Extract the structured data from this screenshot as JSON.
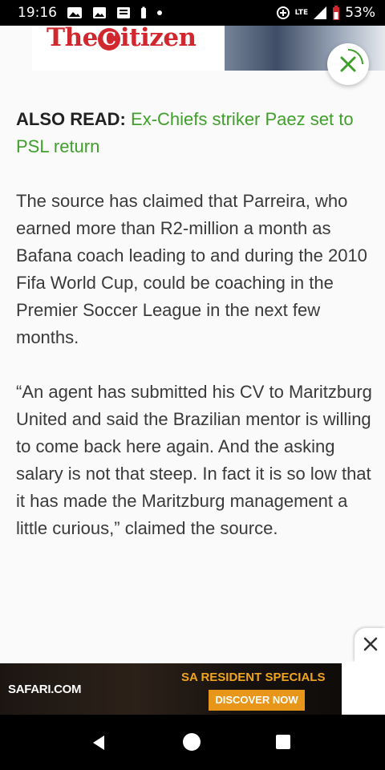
{
  "status_bar": {
    "time": "19:16",
    "network": "LTE",
    "battery": "53%",
    "icons": [
      "photo-icon",
      "image-icon",
      "news-icon",
      "battery-small-icon",
      "dot-icon",
      "data-saver-icon",
      "lte-icon",
      "signal-icon",
      "battery-icon"
    ]
  },
  "header": {
    "logo_pre": "The",
    "logo_badge": "C",
    "logo_post": "itizen",
    "close_icon": "close-icon",
    "accent_color": "#3f9f2a",
    "brand_color": "#d0282e"
  },
  "article": {
    "also_read_label": "ALSO READ:",
    "also_read_link": "Ex-Chiefs striker Paez set to PSL return",
    "paragraphs": [
      "The source has claimed that Parreira, who earned more than R2-million a month as Bafana coach leading to and during the 2010 Fifa World Cup, could be coaching in the Premier Soccer League in the next few months.",
      "“An agent has submitted his CV to Maritzburg United and said the Brazilian mentor is willing to come back here again. And the asking salary is not that steep. In fact it is so low that it has made the Maritzburg management a little curious,” claimed the source."
    ]
  },
  "ad": {
    "brand": "SAFARI.COM",
    "headline": "SA RESIDENT SPECIALS",
    "cta": "DISCOVER NOW",
    "close_icon": "close-icon"
  },
  "nav": {
    "back_icon": "back-icon",
    "home_icon": "home-icon",
    "recents_icon": "recents-icon"
  }
}
